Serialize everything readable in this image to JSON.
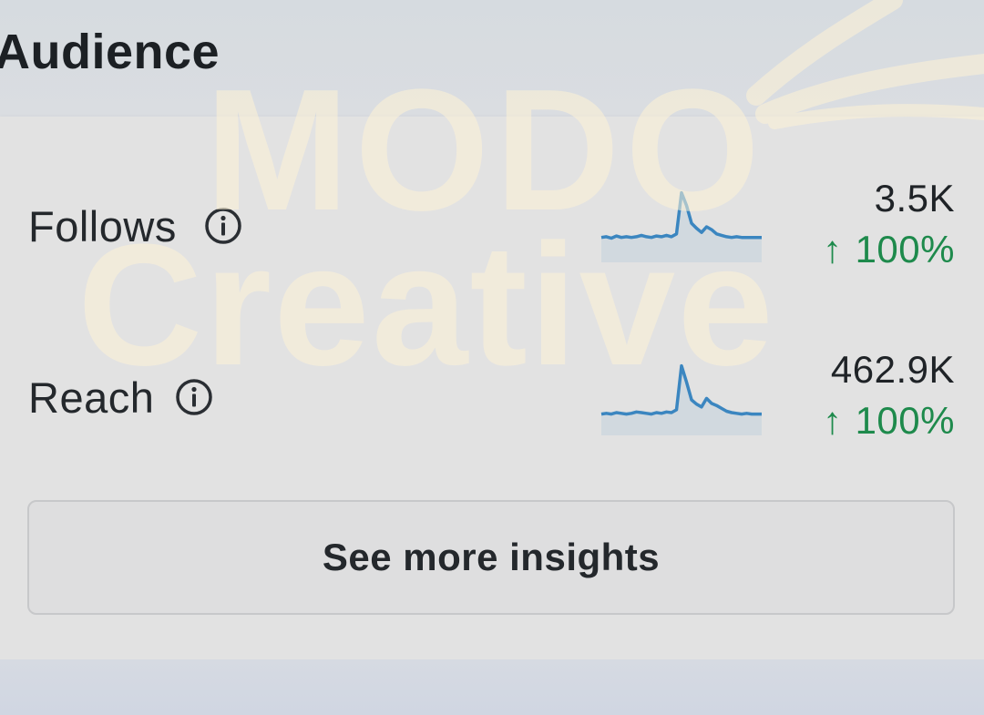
{
  "section": {
    "title": "Audience"
  },
  "metrics": [
    {
      "label": "Follows",
      "value": "3.5K",
      "change_arrow": "↑",
      "change": "100%",
      "icon": "info-icon",
      "trend": [
        0.35,
        0.36,
        0.34,
        0.37,
        0.35,
        0.36,
        0.35,
        0.36,
        0.38,
        0.36,
        0.35,
        0.37,
        0.36,
        0.38,
        0.36,
        0.4,
        0.98,
        0.8,
        0.55,
        0.48,
        0.42,
        0.5,
        0.46,
        0.4,
        0.38,
        0.36,
        0.35,
        0.36,
        0.35,
        0.35,
        0.35,
        0.35,
        0.35
      ]
    },
    {
      "label": "Reach",
      "value": "462.9K",
      "change_arrow": "↑",
      "change": "100%",
      "icon": "info-icon",
      "trend": [
        0.3,
        0.31,
        0.3,
        0.32,
        0.31,
        0.3,
        0.31,
        0.33,
        0.32,
        0.31,
        0.3,
        0.32,
        0.31,
        0.33,
        0.32,
        0.36,
        0.98,
        0.75,
        0.5,
        0.44,
        0.4,
        0.52,
        0.45,
        0.42,
        0.38,
        0.34,
        0.32,
        0.31,
        0.3,
        0.31,
        0.3,
        0.3,
        0.3
      ]
    }
  ],
  "cta": {
    "label": "See more insights"
  },
  "watermark": {
    "line1": "MODO",
    "line2": "Creative"
  },
  "colors": {
    "positive": "#1e8a4c",
    "sparkline": "#3b86c0",
    "watermark": "#fff3d6"
  }
}
